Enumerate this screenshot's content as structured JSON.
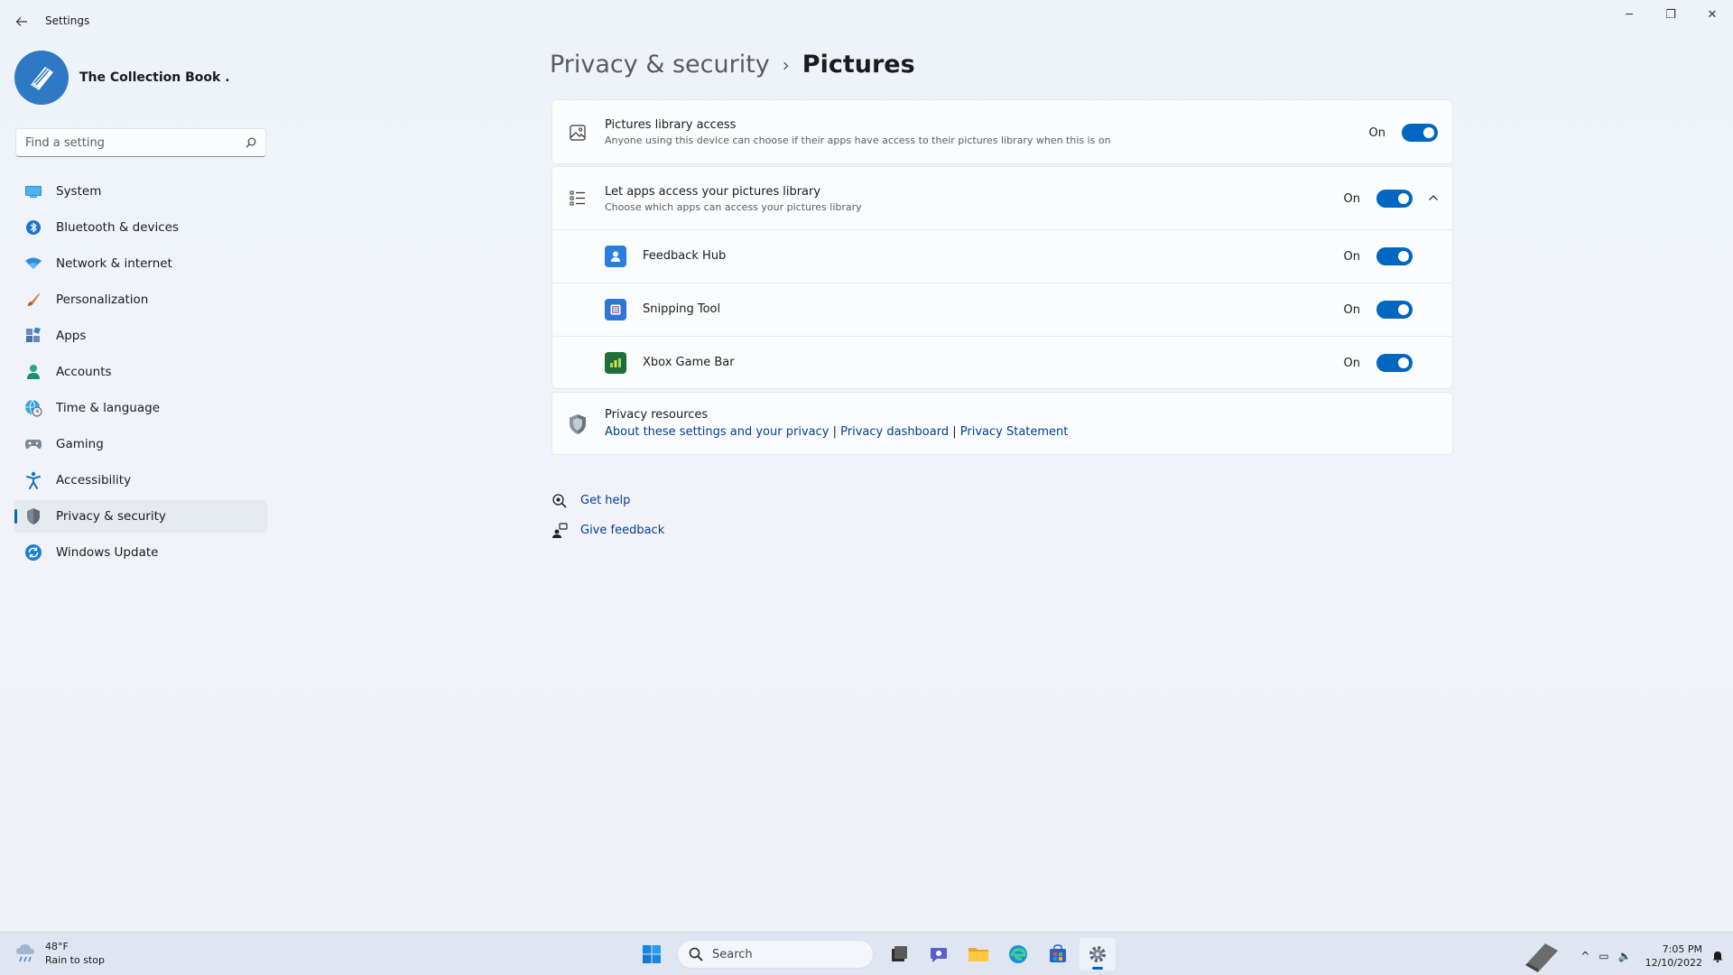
{
  "window": {
    "app_title": "Settings",
    "controls": {
      "minimize": "─",
      "restore": "❐",
      "close": "✕"
    }
  },
  "profile": {
    "name": "The Collection Book ."
  },
  "search": {
    "placeholder": "Find a setting"
  },
  "nav": {
    "items": [
      {
        "label": "System",
        "icon": "system-icon",
        "active": false
      },
      {
        "label": "Bluetooth & devices",
        "icon": "bluetooth-icon",
        "active": false
      },
      {
        "label": "Network & internet",
        "icon": "wifi-icon",
        "active": false
      },
      {
        "label": "Personalization",
        "icon": "brush-icon",
        "active": false
      },
      {
        "label": "Apps",
        "icon": "apps-icon",
        "active": false
      },
      {
        "label": "Accounts",
        "icon": "person-icon",
        "active": false
      },
      {
        "label": "Time & language",
        "icon": "globe-clock-icon",
        "active": false
      },
      {
        "label": "Gaming",
        "icon": "gamepad-icon",
        "active": false
      },
      {
        "label": "Accessibility",
        "icon": "accessibility-icon",
        "active": false
      },
      {
        "label": "Privacy & security",
        "icon": "shield-icon",
        "active": true
      },
      {
        "label": "Windows Update",
        "icon": "update-icon",
        "active": false
      }
    ]
  },
  "breadcrumb": {
    "parent": "Privacy & security",
    "separator": "›",
    "current": "Pictures"
  },
  "library_access": {
    "title": "Pictures library access",
    "subtitle": "Anyone using this device can choose if their apps have access to their pictures library when this is on",
    "state_label": "On"
  },
  "apps_access": {
    "title": "Let apps access your pictures library",
    "subtitle": "Choose which apps can access your pictures library",
    "state_label": "On",
    "apps": [
      {
        "name": "Feedback Hub",
        "state_label": "On"
      },
      {
        "name": "Snipping Tool",
        "state_label": "On"
      },
      {
        "name": "Xbox Game Bar",
        "state_label": "On"
      }
    ]
  },
  "privacy_resources": {
    "title": "Privacy resources",
    "links": [
      "About these settings and your privacy",
      "Privacy dashboard",
      "Privacy Statement"
    ],
    "separator": "|"
  },
  "help": {
    "get_help": "Get help",
    "give_feedback": "Give feedback"
  },
  "taskbar": {
    "weather_temp": "48°F",
    "weather_desc": "Rain to stop",
    "search_label": "Search",
    "time": "7:05 PM",
    "date": "12/10/2022"
  },
  "colors": {
    "accent": "#0067c0",
    "link": "#003e92"
  }
}
